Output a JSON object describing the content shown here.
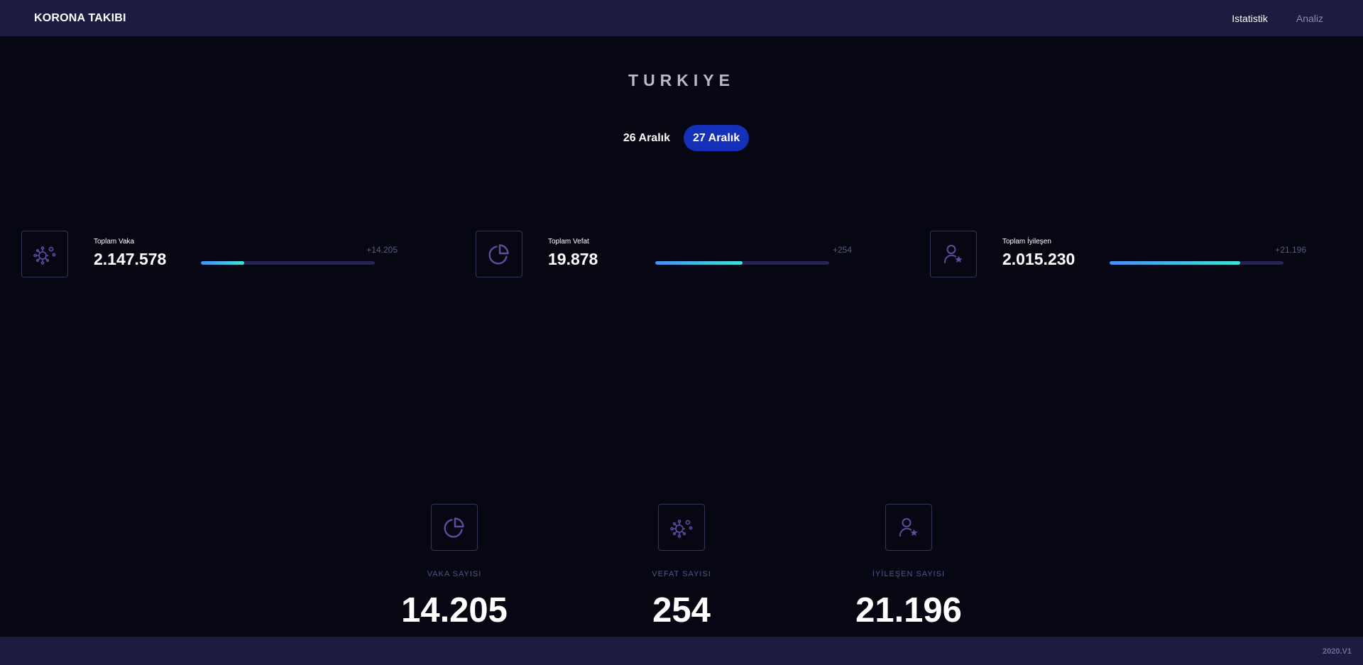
{
  "header": {
    "brand": "KORONA TAKIBI",
    "nav": [
      {
        "label": "Istatistik",
        "active": true
      },
      {
        "label": "Analiz",
        "active": false
      }
    ]
  },
  "country": "TURKIYE",
  "date_tabs": [
    {
      "label": "26 Aralık",
      "active": false
    },
    {
      "label": "27 Aralık",
      "active": true
    }
  ],
  "totals": [
    {
      "icon": "virus-icon",
      "label": "Toplam Vaka",
      "value": "2.147.578",
      "delta": "+14.205",
      "progress": 0.25
    },
    {
      "icon": "pie-chart-icon",
      "label": "Toplam Vefat",
      "value": "19.878",
      "delta": "+254",
      "progress": 0.5
    },
    {
      "icon": "user-star-icon",
      "label": "Toplam İyileşen",
      "value": "2.015.230",
      "delta": "+21.196",
      "progress": 0.75
    }
  ],
  "daily": [
    {
      "icon": "pie-chart-icon",
      "label": "VAKA SAYISI",
      "value": "14.205"
    },
    {
      "icon": "virus-icon",
      "label": "VEFAT SAYISI",
      "value": "254"
    },
    {
      "icon": "user-star-icon",
      "label": "İYİLEŞEN SAYISI",
      "value": "21.196"
    }
  ],
  "footer": {
    "version": "2020.V1"
  },
  "colors": {
    "background": "#070713",
    "navbar": "#1c1c40",
    "active_tab": "#1430b8",
    "bar_start": "#4a8ef5",
    "bar_end": "#3fe3d6",
    "icon_stroke": "#5a4f9e"
  }
}
